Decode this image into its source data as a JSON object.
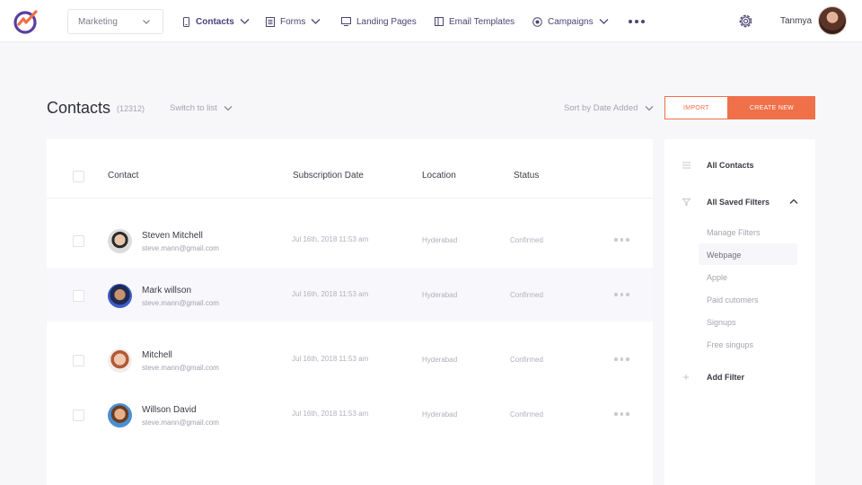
{
  "nav": {
    "workspace": "Marketing",
    "items": [
      {
        "label": "Contacts",
        "icon": "phone-icon",
        "dropdown": true,
        "active": true
      },
      {
        "label": "Forms",
        "icon": "form-icon",
        "dropdown": true
      },
      {
        "label": "Landing Pages",
        "icon": "monitor-icon",
        "dropdown": false
      },
      {
        "label": "Email Templates",
        "icon": "template-icon",
        "dropdown": false
      },
      {
        "label": "Campaigns",
        "icon": "globe-icon",
        "dropdown": true
      }
    ],
    "user_name": "Tanmya"
  },
  "header": {
    "title": "Contacts",
    "count": "(12312)",
    "switch_label": "Switch to list",
    "sort_label": "Sort by Date Added",
    "import_label": "IMPORT",
    "create_label": "CREATE NEW"
  },
  "table": {
    "columns": [
      "Contact",
      "Subscription Date",
      "Location",
      "Status"
    ],
    "rows": [
      {
        "name": "Steven Mitchell",
        "email": "steve.mann@gmail.com",
        "date": "Jul 16th, 2018 11:53 am",
        "location": "Hyderabad",
        "status": "Confirmed"
      },
      {
        "name": "Mark willson",
        "email": "steve.mann@gmail.com",
        "date": "Jul 16th, 2018 11:53 am",
        "location": "Hyderabad",
        "status": "Confirmed"
      },
      {
        "name": "Mitchell",
        "email": "steve.mann@gmail.com",
        "date": "Jul 16th, 2018 11:53 am",
        "location": "Hyderabad",
        "status": "Confirmed"
      },
      {
        "name": "Willson David",
        "email": "steve.mann@gmail.com",
        "date": "Jul 16th, 2018 11:53 am",
        "location": "Hyderabad",
        "status": "Confirmed"
      }
    ]
  },
  "sidebar": {
    "all_contacts": "All Contacts",
    "saved_filters": "All Saved Filters",
    "filters": [
      "Manage Filters",
      "Webpage",
      "Apple",
      "Paid cutomers",
      "Signups",
      "Free singups"
    ],
    "add_filter": "Add Filter"
  },
  "colors": {
    "accent": "#f0704a",
    "nav_text": "#4d4373",
    "logo_purple": "#5b3fa0"
  }
}
